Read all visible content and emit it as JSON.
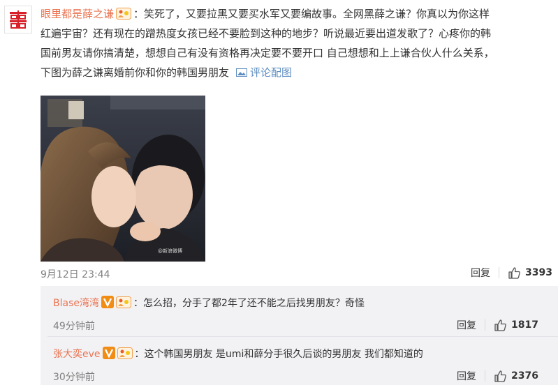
{
  "post": {
    "username": "眼里都是薛之谦",
    "text_line1": "：笑死了，又要拉黑又要买水军又要编故事。全网黑薛之谦？你真以为你这样",
    "text_line2": "红遍宇宙？还有现在的蹭热度女孩已经不要脸到这种的地步？听说最近要出道发歌了？心疼你的韩",
    "text_line3": "国前男友请你搞清楚，想想自己有没有资格再决定要不要开口 自己想想和上上谦合伙人什么关系，",
    "text_line4": "下图为薛之谦离婚前你和你的韩国男朋友",
    "pic_link": "评论配图",
    "time": "9月12日 23:44",
    "reply_label": "回复",
    "likes": "3393"
  },
  "replies": [
    {
      "username": "Blase湾湾",
      "text": "：怎么招，分手了都2年了还不能之后找男朋友？奇怪",
      "time": "49分钟前",
      "reply_label": "回复",
      "likes": "1817"
    },
    {
      "username": "张大奕eve",
      "text": "：这个韩国男朋友 是umi和薛分手很久后谈的男朋友 我们都知道的",
      "time": "30分钟前",
      "reply_label": "回复",
      "likes": "2376"
    }
  ],
  "colors": {
    "username": "#eb7350",
    "link": "#5d8cc0",
    "muted": "#808080",
    "reply_bg": "#f2f2f5"
  },
  "icons": {
    "avatar": "double-happiness-icon",
    "fan_badge": "fan-badge-icon",
    "verified": "v-badge-icon",
    "picture": "picture-icon",
    "like": "thumbs-up-icon"
  }
}
